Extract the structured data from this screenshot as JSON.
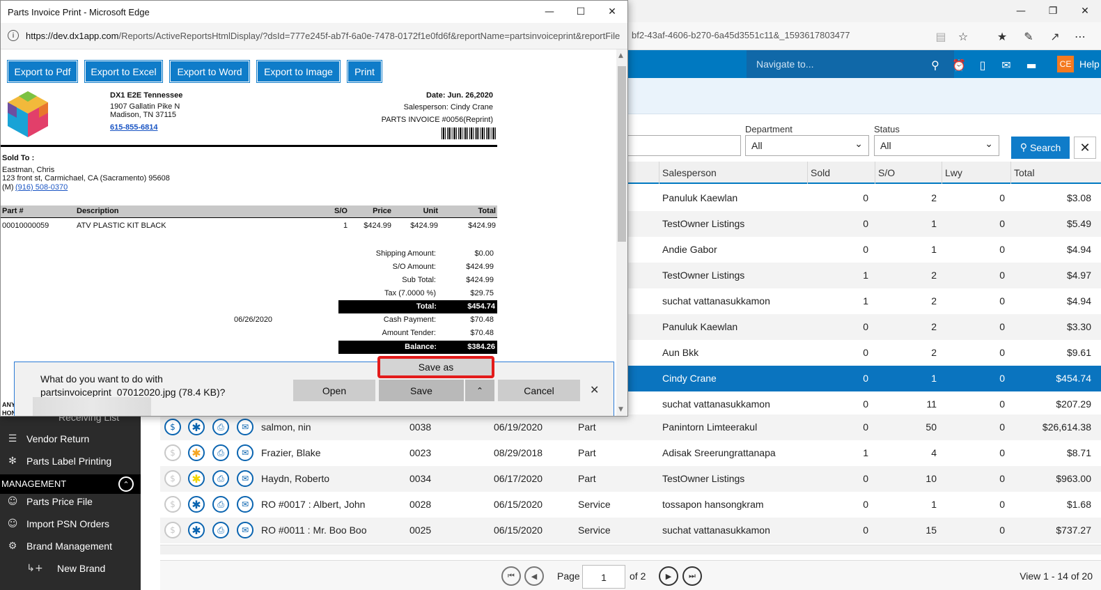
{
  "bg_browser": {
    "url_tail": "bf2-43af-4606-b270-6a45d3551c11&_1593617803477"
  },
  "app": {
    "nav_placeholder": "Navigate to...",
    "avatar": "CE",
    "help": "Help"
  },
  "filters": {
    "department_label": "Department",
    "department_value": "All",
    "status_label": "Status",
    "status_value": "All",
    "search_label": "Search"
  },
  "grid": {
    "headers": {
      "salesperson": "Salesperson",
      "sold": "Sold",
      "so": "S/O",
      "lwy": "Lwy",
      "total": "Total"
    },
    "rows_partial": [
      {
        "salesperson": "Panuluk Kaewlan",
        "sold": "0",
        "so": "2",
        "lwy": "0",
        "total": "$3.08"
      },
      {
        "salesperson": "TestOwner Listings",
        "sold": "0",
        "so": "1",
        "lwy": "0",
        "total": "$5.49"
      },
      {
        "salesperson": "Andie Gabor",
        "sold": "0",
        "so": "1",
        "lwy": "0",
        "total": "$4.94"
      },
      {
        "salesperson": "TestOwner Listings",
        "sold": "1",
        "so": "2",
        "lwy": "0",
        "total": "$4.97"
      },
      {
        "salesperson": "suchat vattanasukkamon",
        "sold": "1",
        "so": "2",
        "lwy": "0",
        "total": "$4.94"
      },
      {
        "salesperson": "Panuluk Kaewlan",
        "sold": "0",
        "so": "2",
        "lwy": "0",
        "total": "$3.30"
      },
      {
        "salesperson": "Aun Bkk",
        "sold": "0",
        "so": "2",
        "lwy": "0",
        "total": "$9.61"
      },
      {
        "salesperson": "Cindy Crane",
        "sold": "0",
        "so": "1",
        "lwy": "0",
        "total": "$454.74"
      },
      {
        "salesperson": "suchat vattanasukkamon",
        "sold": "0",
        "so": "11",
        "lwy": "0",
        "total": "$207.29"
      }
    ],
    "rows_full": [
      {
        "customer": "salmon, nin",
        "number": "0038",
        "date": "06/19/2020",
        "type": "Part",
        "salesperson": "Panintorn Limteerakul",
        "sold": "0",
        "so": "50",
        "lwy": "0",
        "total": "$26,614.38"
      },
      {
        "customer": "Frazier, Blake",
        "number": "0023",
        "date": "08/29/2018",
        "type": "Part",
        "salesperson": "Adisak Sreerungrattanapa",
        "sold": "1",
        "so": "4",
        "lwy": "0",
        "total": "$8.71"
      },
      {
        "customer": "Haydn, Roberto",
        "number": "0034",
        "date": "06/17/2020",
        "type": "Part",
        "salesperson": "TestOwner Listings",
        "sold": "0",
        "so": "10",
        "lwy": "0",
        "total": "$963.00"
      },
      {
        "customer": "RO #0017 : Albert, John",
        "number": "0028",
        "date": "06/15/2020",
        "type": "Service",
        "salesperson": "tossapon hansongkram",
        "sold": "0",
        "so": "1",
        "lwy": "0",
        "total": "$1.68"
      },
      {
        "customer": "RO #0011 : Mr. Boo Boo",
        "number": "0025",
        "date": "06/15/2020",
        "type": "Service",
        "salesperson": "suchat vattanasukkamon",
        "sold": "0",
        "so": "15",
        "lwy": "0",
        "total": "$737.27"
      }
    ]
  },
  "pager": {
    "page_label": "Page",
    "page_value": "1",
    "of_label": "of 2",
    "view_label": "View 1 - 14 of 20"
  },
  "sidebar": {
    "partial_item": "Receiving List",
    "items": [
      "Vendor Return",
      "Parts Label Printing"
    ],
    "section": "MANAGEMENT",
    "mgmt_items": [
      "Parts Price File",
      "Import PSN Orders",
      "Brand Management"
    ],
    "sub_item": "New Brand"
  },
  "popup": {
    "title": "Parts Invoice Print - Microsoft Edge",
    "url_host": "https://dev.dx1app.com",
    "url_path": "/Reports/ActiveReportsHtmlDisplay/?dsId=777e245f-ab7f-6a0e-7478-0172f1e0fd6f&reportName=partsinvoiceprint&reportFile",
    "buttons": [
      "Export to Pdf",
      "Export to Excel",
      "Export to Word",
      "Export to Image",
      "Print"
    ]
  },
  "invoice": {
    "company": "DX1 E2E Tennessee",
    "addr1": "1907 Gallatin Pike N",
    "addr2": "Madison, TN 37115",
    "phone": "615-855-6814",
    "date": "Date: Jun. 26,2020",
    "salesperson": "Salesperson: Cindy Crane",
    "invoice_no": "PARTS INVOICE #0056(Reprint)",
    "sold_to_label": "Sold To :",
    "cust_name": "Eastman, Chris",
    "cust_addr": "123 front st, Carmichael, CA (Sacramento) 95608",
    "cust_phone_prefix": "(M)",
    "cust_phone": "(916) 508-0370",
    "col_part": "Part #",
    "col_desc": "Description",
    "col_so": "S/O",
    "col_price": "Price",
    "col_unit": "Unit",
    "col_total": "Total",
    "line_part": "00010000059",
    "line_desc": "ATV PLASTIC KIT BLACK",
    "line_so": "1",
    "line_price": "$424.99",
    "line_unit": "$424.99",
    "line_total": "$424.99",
    "shipping_label": "Shipping Amount:",
    "shipping": "$0.00",
    "so_label": "S/O Amount:",
    "so_amount": "$424.99",
    "subtotal_label": "Sub Total:",
    "subtotal": "$424.99",
    "tax_label": "Tax (7.0000 %)",
    "tax": "$29.75",
    "total_label": "Total:",
    "total": "$454.74",
    "pay_date": "06/26/2020",
    "cash_label": "Cash Payment:",
    "cash": "$70.48",
    "tender_label": "Amount Tender:",
    "tender": "$70.48",
    "balance_label": "Balance:",
    "balance": "$384.26",
    "cut_line1": "ANY",
    "cut_line2": "HON"
  },
  "download": {
    "question": "What do you want to do with",
    "filename": "partsinvoiceprint_07012020.jpg (78.4 KB)?",
    "open": "Open",
    "save": "Save",
    "cancel": "Cancel",
    "save_as": "Save as"
  }
}
